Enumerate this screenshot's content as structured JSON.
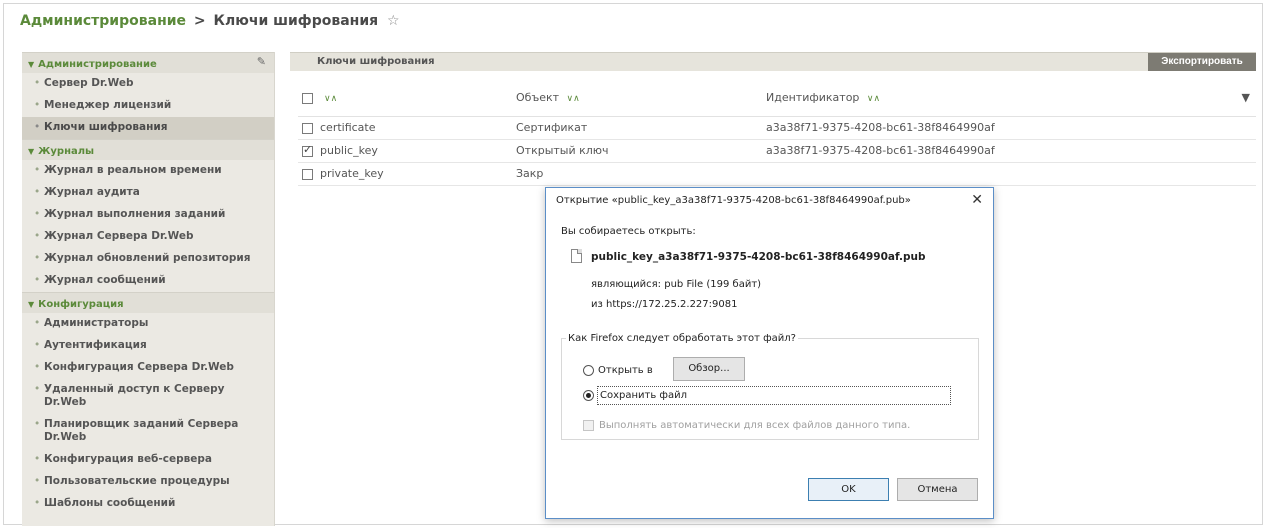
{
  "breadcrumb": {
    "root": "Администрирование",
    "separator": ">",
    "current": "Ключи шифрования",
    "star": "☆"
  },
  "sidebar": {
    "pin": "📌",
    "sections": [
      {
        "title": "Администрирование",
        "items": [
          {
            "label": "Сервер Dr.Web",
            "active": false
          },
          {
            "label": "Менеджер лицензий",
            "active": false
          },
          {
            "label": "Ключи шифрования",
            "active": true
          }
        ]
      },
      {
        "title": "Журналы",
        "items": [
          {
            "label": "Журнал в реальном времени",
            "active": false
          },
          {
            "label": "Журнал аудита",
            "active": false
          },
          {
            "label": "Журнал выполнения заданий",
            "active": false
          },
          {
            "label": "Журнал Сервера Dr.Web",
            "active": false
          },
          {
            "label": "Журнал обновлений репозитория",
            "active": false
          },
          {
            "label": "Журнал сообщений",
            "active": false
          }
        ]
      },
      {
        "title": "Конфигурация",
        "items": [
          {
            "label": "Администраторы",
            "active": false
          },
          {
            "label": "Аутентификация",
            "active": false
          },
          {
            "label": "Конфигурация Сервера Dr.Web",
            "active": false
          },
          {
            "label": "Удаленный доступ к Серверу Dr.Web",
            "active": false
          },
          {
            "label": "Планировщик заданий Сервера Dr.Web",
            "active": false
          },
          {
            "label": "Конфигурация веб-сервера",
            "active": false
          },
          {
            "label": "Пользовательские процедуры",
            "active": false
          },
          {
            "label": "Шаблоны сообщений",
            "active": false
          }
        ]
      }
    ]
  },
  "panel": {
    "title": "Ключи шифрования",
    "export_label": "Экспортировать"
  },
  "table": {
    "sort_glyph": "∨∧",
    "filter_glyph": "▼",
    "columns": [
      "",
      "Объект",
      "Идентификатор"
    ],
    "rows": [
      {
        "checked": false,
        "name": "certificate",
        "object": "Сертификат",
        "id": "a3a38f71-9375-4208-bc61-38f8464990af"
      },
      {
        "checked": true,
        "name": "public_key",
        "object": "Открытый ключ",
        "id": "a3a38f71-9375-4208-bc61-38f8464990af"
      },
      {
        "checked": false,
        "name": "private_key",
        "object": "Закр",
        "id": ""
      }
    ]
  },
  "dialog": {
    "title": "Открытие «public_key_a3a38f71-9375-4208-bc61-38f8464990af.pub»",
    "close": "✕",
    "intro": "Вы собираетесь открыть:",
    "file_name": "public_key_a3a38f71-9375-4208-bc61-38f8464990af.pub",
    "type_label": "являющийся:",
    "type_value": "pub File (199 байт)",
    "from_label": "из",
    "from_value": "https://172.25.2.227:9081",
    "question": "Как Firefox следует обработать этот файл?",
    "open_with_label": "Открыть в",
    "browse_label": "Обзор...",
    "save_label": "Сохранить файл",
    "auto_label": "Выполнять автоматически для всех файлов данного типа.",
    "selected_option": "save",
    "ok_label": "OK",
    "cancel_label": "Отмена"
  }
}
